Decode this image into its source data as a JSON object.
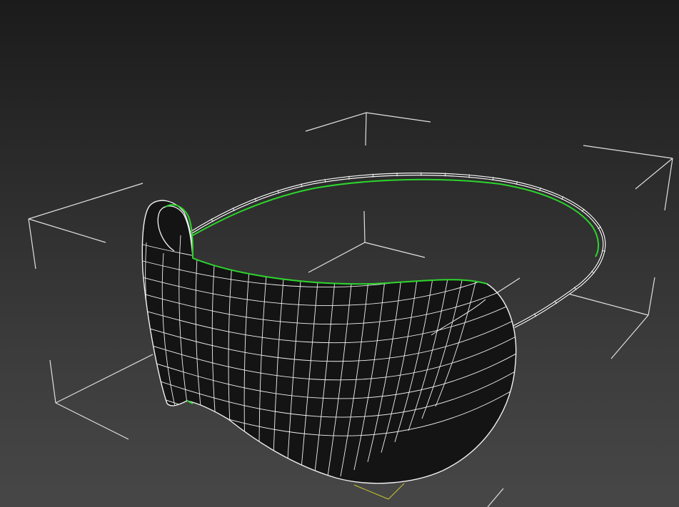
{
  "viewport": {
    "background_top": "#1b1b1b",
    "background_bottom": "#474747",
    "gizmo_color": "#e0e0e0",
    "wire_color": "#f2f2f2",
    "surface_color": "#141414",
    "selection_color": "#2cd52c",
    "pivot_color": "#c8c832"
  },
  "selection": {
    "state": "selected"
  }
}
